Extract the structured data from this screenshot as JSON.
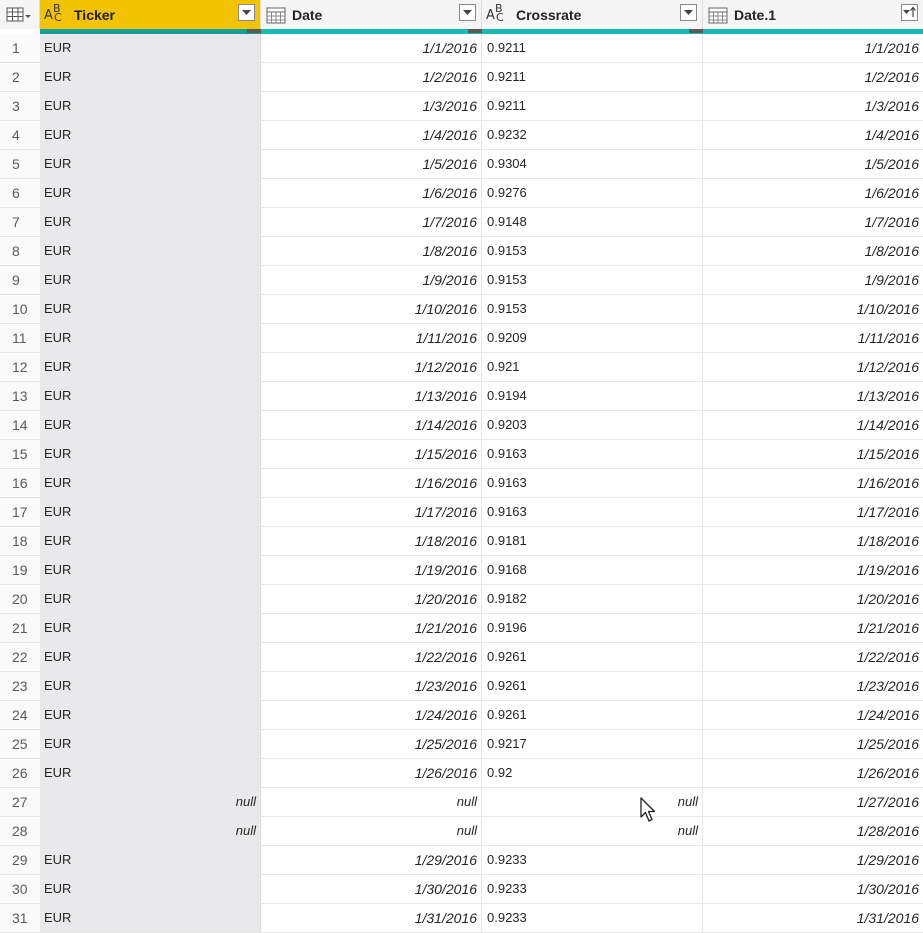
{
  "columns": {
    "ticker": {
      "name": "Ticker",
      "type_icon": "abc-text-icon"
    },
    "date": {
      "name": "Date",
      "type_icon": "calendar-icon"
    },
    "crossrate": {
      "name": "Crossrate",
      "type_icon": "abc-text-icon"
    },
    "date1": {
      "name": "Date.1",
      "type_icon": "calendar-icon"
    }
  },
  "type_icon_text": {
    "a": "A",
    "b": "B",
    "c": "C"
  },
  "colors": {
    "selected_header": "#f2c300",
    "quality_bar": "#1bb8b1"
  },
  "rows": [
    {
      "n": "1",
      "ticker": "EUR",
      "date": "1/1/2016",
      "crossrate": "0.9211",
      "date1": "1/1/2016"
    },
    {
      "n": "2",
      "ticker": "EUR",
      "date": "1/2/2016",
      "crossrate": "0.9211",
      "date1": "1/2/2016"
    },
    {
      "n": "3",
      "ticker": "EUR",
      "date": "1/3/2016",
      "crossrate": "0.9211",
      "date1": "1/3/2016"
    },
    {
      "n": "4",
      "ticker": "EUR",
      "date": "1/4/2016",
      "crossrate": "0.9232",
      "date1": "1/4/2016"
    },
    {
      "n": "5",
      "ticker": "EUR",
      "date": "1/5/2016",
      "crossrate": "0.9304",
      "date1": "1/5/2016"
    },
    {
      "n": "6",
      "ticker": "EUR",
      "date": "1/6/2016",
      "crossrate": "0.9276",
      "date1": "1/6/2016"
    },
    {
      "n": "7",
      "ticker": "EUR",
      "date": "1/7/2016",
      "crossrate": "0.9148",
      "date1": "1/7/2016"
    },
    {
      "n": "8",
      "ticker": "EUR",
      "date": "1/8/2016",
      "crossrate": "0.9153",
      "date1": "1/8/2016"
    },
    {
      "n": "9",
      "ticker": "EUR",
      "date": "1/9/2016",
      "crossrate": "0.9153",
      "date1": "1/9/2016"
    },
    {
      "n": "10",
      "ticker": "EUR",
      "date": "1/10/2016",
      "crossrate": "0.9153",
      "date1": "1/10/2016"
    },
    {
      "n": "11",
      "ticker": "EUR",
      "date": "1/11/2016",
      "crossrate": "0.9209",
      "date1": "1/11/2016"
    },
    {
      "n": "12",
      "ticker": "EUR",
      "date": "1/12/2016",
      "crossrate": "0.921",
      "date1": "1/12/2016"
    },
    {
      "n": "13",
      "ticker": "EUR",
      "date": "1/13/2016",
      "crossrate": "0.9194",
      "date1": "1/13/2016"
    },
    {
      "n": "14",
      "ticker": "EUR",
      "date": "1/14/2016",
      "crossrate": "0.9203",
      "date1": "1/14/2016"
    },
    {
      "n": "15",
      "ticker": "EUR",
      "date": "1/15/2016",
      "crossrate": "0.9163",
      "date1": "1/15/2016"
    },
    {
      "n": "16",
      "ticker": "EUR",
      "date": "1/16/2016",
      "crossrate": "0.9163",
      "date1": "1/16/2016"
    },
    {
      "n": "17",
      "ticker": "EUR",
      "date": "1/17/2016",
      "crossrate": "0.9163",
      "date1": "1/17/2016"
    },
    {
      "n": "18",
      "ticker": "EUR",
      "date": "1/18/2016",
      "crossrate": "0.9181",
      "date1": "1/18/2016"
    },
    {
      "n": "19",
      "ticker": "EUR",
      "date": "1/19/2016",
      "crossrate": "0.9168",
      "date1": "1/19/2016"
    },
    {
      "n": "20",
      "ticker": "EUR",
      "date": "1/20/2016",
      "crossrate": "0.9182",
      "date1": "1/20/2016"
    },
    {
      "n": "21",
      "ticker": "EUR",
      "date": "1/21/2016",
      "crossrate": "0.9196",
      "date1": "1/21/2016"
    },
    {
      "n": "22",
      "ticker": "EUR",
      "date": "1/22/2016",
      "crossrate": "0.9261",
      "date1": "1/22/2016"
    },
    {
      "n": "23",
      "ticker": "EUR",
      "date": "1/23/2016",
      "crossrate": "0.9261",
      "date1": "1/23/2016"
    },
    {
      "n": "24",
      "ticker": "EUR",
      "date": "1/24/2016",
      "crossrate": "0.9261",
      "date1": "1/24/2016"
    },
    {
      "n": "25",
      "ticker": "EUR",
      "date": "1/25/2016",
      "crossrate": "0.9217",
      "date1": "1/25/2016"
    },
    {
      "n": "26",
      "ticker": "EUR",
      "date": "1/26/2016",
      "crossrate": "0.92",
      "date1": "1/26/2016"
    },
    {
      "n": "27",
      "ticker": "null",
      "date": "null",
      "crossrate": "null",
      "date1": "1/27/2016"
    },
    {
      "n": "28",
      "ticker": "null",
      "date": "null",
      "crossrate": "null",
      "date1": "1/28/2016"
    },
    {
      "n": "29",
      "ticker": "EUR",
      "date": "1/29/2016",
      "crossrate": "0.9233",
      "date1": "1/29/2016"
    },
    {
      "n": "30",
      "ticker": "EUR",
      "date": "1/30/2016",
      "crossrate": "0.9233",
      "date1": "1/30/2016"
    },
    {
      "n": "31",
      "ticker": "EUR",
      "date": "1/31/2016",
      "crossrate": "0.9233",
      "date1": "1/31/2016"
    }
  ]
}
